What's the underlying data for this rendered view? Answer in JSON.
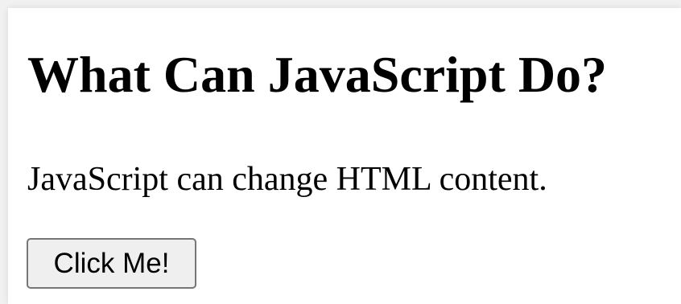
{
  "page": {
    "heading": "What Can JavaScript Do?",
    "paragraph": "JavaScript can change HTML content.",
    "button_label": "Click Me!"
  },
  "colors": {
    "background": "#ffffff",
    "text": "#000000",
    "button_background": "#efefef",
    "button_border": "#767676"
  }
}
